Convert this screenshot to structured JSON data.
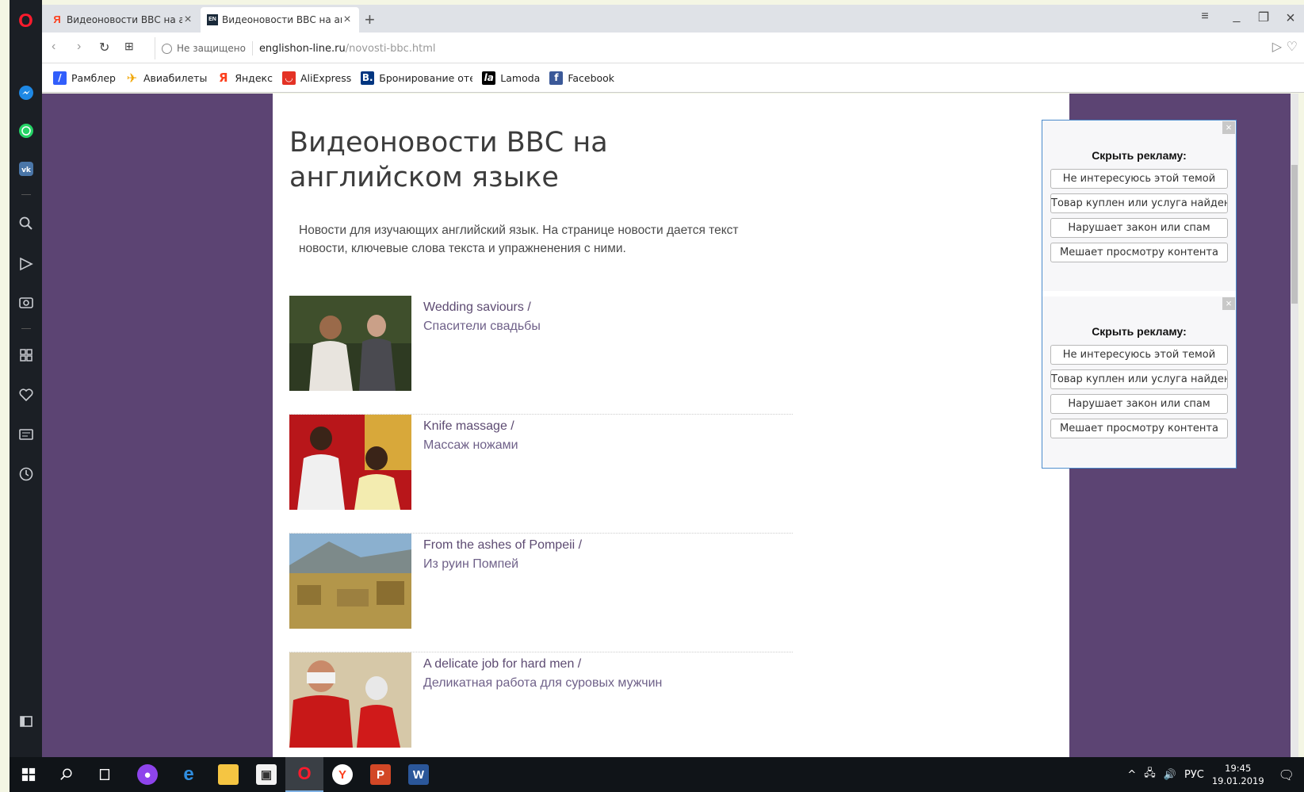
{
  "browser": {
    "tabs": [
      {
        "title": "Видеоновости ВВС на анг",
        "favicon": "yandex-icon",
        "active": false
      },
      {
        "title": "Видеоновости ВВС на анг",
        "favicon": "eng-icon",
        "active": true
      }
    ],
    "address": {
      "security": "Не защищено",
      "host": "englishon-line.ru",
      "path": "/novosti-bbc.html"
    },
    "bookmarks": [
      {
        "label": "Рамблер",
        "icon": "rambler-icon",
        "color": "#315efb"
      },
      {
        "label": "Авиабилеты",
        "icon": "airplane-icon",
        "color": "#f0a500"
      },
      {
        "label": "Яндекс",
        "icon": "yandex-icon",
        "color": "#fc3f1d"
      },
      {
        "label": "AliExpress",
        "icon": "aliexpress-icon",
        "color": "#e43225"
      },
      {
        "label": "Бронирование отеле",
        "icon": "booking-icon",
        "color": "#003580"
      },
      {
        "label": "Lamoda",
        "icon": "lamoda-icon",
        "color": "#000000"
      },
      {
        "label": "Facebook",
        "icon": "facebook-icon",
        "color": "#3b5998"
      }
    ]
  },
  "page": {
    "title": "Видеоновости ВВС на английском языке",
    "intro": "Новости для изучающих английский язык. На странице новости дается текст новости, ключевые слова текста и упражненения с ними.",
    "news": [
      {
        "en": "Wedding saviours /",
        "ru": "Спасители свадьбы"
      },
      {
        "en": "Knife massage /",
        "ru": "Массаж ножами"
      },
      {
        "en": "From the ashes of Pompeii /",
        "ru": "Из руин Помпей"
      },
      {
        "en": "A delicate job for hard men /",
        "ru": "Деликатная работа для суровых мужчин"
      }
    ],
    "ad_hide": [
      {
        "heading": "Скрыть рекламу:",
        "options": [
          "Не интересуюсь этой темой",
          "Товар куплен или услуга найдена",
          "Нарушает закон или спам",
          "Мешает просмотру контента"
        ]
      },
      {
        "heading": "Скрыть рекламу:",
        "options": [
          "Не интересуюсь этой темой",
          "Товар куплен или услуга найдена",
          "Нарушает закон или спам",
          "Мешает просмотру контента"
        ]
      }
    ]
  },
  "taskbar": {
    "language": "РУС",
    "time": "19:45",
    "date": "19.01.2019"
  },
  "colors": {
    "page_background": "#5c4473",
    "link_en": "#5d4b72",
    "link_ru": "#6f6189",
    "ad_border": "#4a8acb"
  }
}
